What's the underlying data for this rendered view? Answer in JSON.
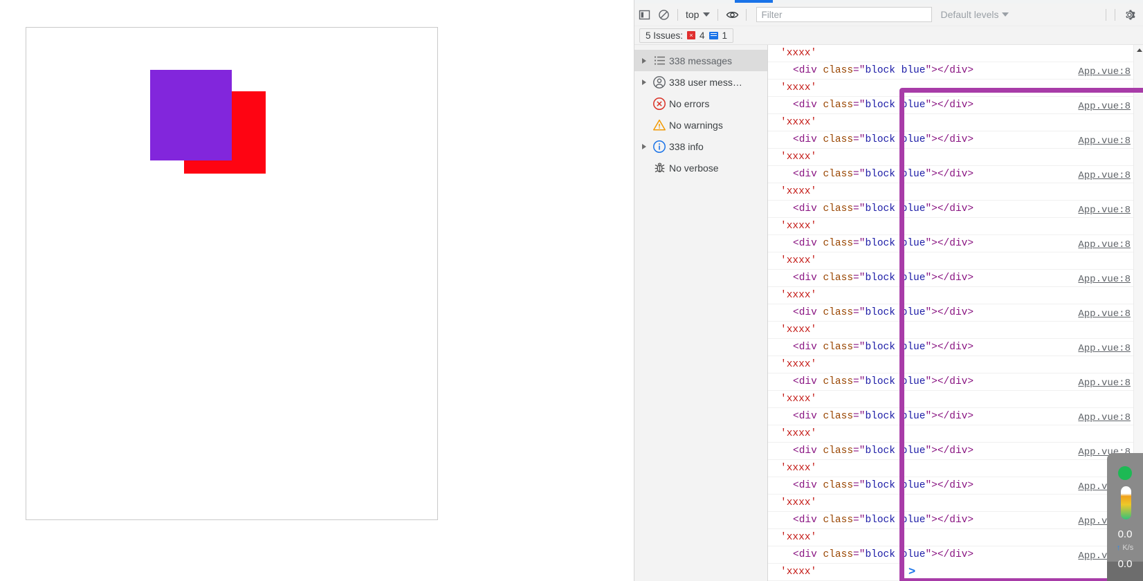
{
  "page": {
    "blocks": [
      {
        "name": "purple-block",
        "class": "block purple",
        "color": "#8226dc"
      },
      {
        "name": "red-block",
        "class": "block red",
        "color": "#fe0412"
      }
    ]
  },
  "devtools": {
    "toolbar": {
      "sidebar_toggle_icon": "panel-toggle-icon",
      "clear_console_icon": "clear-console-icon",
      "context_label": "top",
      "eye_icon": "live-expression-icon",
      "filter_placeholder": "Filter",
      "filter_value": "",
      "levels_label": "Default levels",
      "settings_icon": "gear-icon"
    },
    "issues": {
      "label": "5 Issues:",
      "error_count": "4",
      "info_count": "1",
      "error_glyph": "×"
    },
    "sidebar": {
      "items": [
        {
          "name": "sidebar-item-messages",
          "label": "338 messages",
          "icon": "list-icon",
          "arrow": true,
          "selected": true
        },
        {
          "name": "sidebar-item-user-messages",
          "label": "338 user mess…",
          "icon": "user-icon",
          "arrow": true,
          "selected": false
        },
        {
          "name": "sidebar-item-errors",
          "label": "No errors",
          "icon": "error-icon",
          "arrow": false,
          "selected": false
        },
        {
          "name": "sidebar-item-warnings",
          "label": "No warnings",
          "icon": "warning-icon",
          "arrow": false,
          "selected": false
        },
        {
          "name": "sidebar-item-info",
          "label": "338 info",
          "icon": "info-icon",
          "arrow": true,
          "selected": false
        },
        {
          "name": "sidebar-item-verbose",
          "label": "No verbose",
          "icon": "bug-icon",
          "arrow": false,
          "selected": false
        }
      ]
    },
    "console": {
      "string_literal": "'xxxx'",
      "source_link": "App.vue:8",
      "prompt_caret": ">",
      "element_markup": {
        "open_lt": "<",
        "tag": "div",
        "attr": "class",
        "eq_quote": "=\"",
        "attr_value": "block blue",
        "quote_gt": "\">",
        "close": "</div>"
      },
      "rows": [
        {
          "kind": "string"
        },
        {
          "kind": "element"
        },
        {
          "kind": "string"
        },
        {
          "kind": "element"
        },
        {
          "kind": "string"
        },
        {
          "kind": "element"
        },
        {
          "kind": "string"
        },
        {
          "kind": "element"
        },
        {
          "kind": "string"
        },
        {
          "kind": "element"
        },
        {
          "kind": "string"
        },
        {
          "kind": "element"
        },
        {
          "kind": "string"
        },
        {
          "kind": "element"
        },
        {
          "kind": "string"
        },
        {
          "kind": "element"
        },
        {
          "kind": "string"
        },
        {
          "kind": "element"
        },
        {
          "kind": "string"
        },
        {
          "kind": "element"
        },
        {
          "kind": "string"
        },
        {
          "kind": "element"
        },
        {
          "kind": "string"
        },
        {
          "kind": "element"
        },
        {
          "kind": "string"
        },
        {
          "kind": "element"
        },
        {
          "kind": "string"
        },
        {
          "kind": "element"
        },
        {
          "kind": "string"
        },
        {
          "kind": "element"
        },
        {
          "kind": "string"
        }
      ]
    },
    "highlight": {
      "name": "inspect-highlight-overlay",
      "color": "#a83ca8"
    }
  },
  "net_widget": {
    "upload_value": "0.0",
    "download_value": "0.0",
    "unit": "K/s",
    "unit_arrow": "↑",
    "status_color": "#1db954"
  }
}
